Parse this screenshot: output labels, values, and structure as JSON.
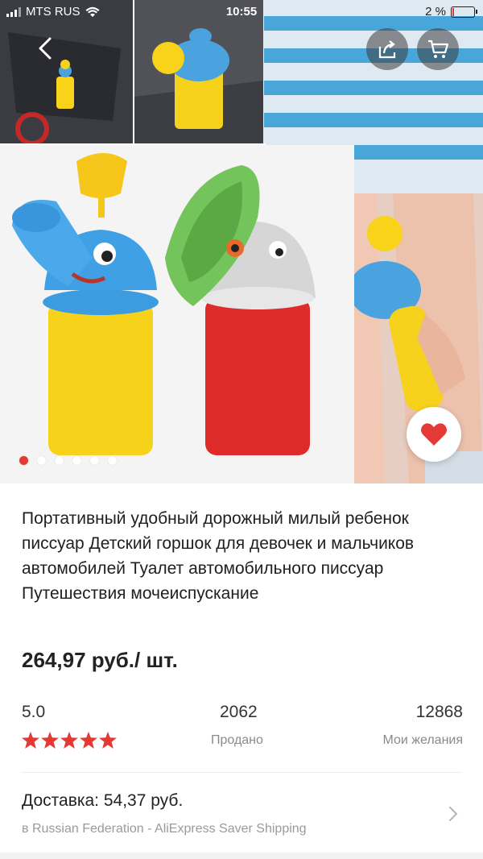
{
  "status_bar": {
    "carrier": "MTS RUS",
    "time": "10:55",
    "battery": "2 %"
  },
  "gallery": {
    "image_count": 6,
    "active_index": 0
  },
  "product": {
    "title": "Портативный удобный дорожный милый ребенок писсуар Детский горшок для девочек и мальчиков автомобилей Туалет автомобильного писсуар Путешествия мочеиспускание",
    "price": "264,97 руб./ шт."
  },
  "stats": {
    "rating": "5.0",
    "stars": 5,
    "sold_count": "2062",
    "sold_label": "Продано",
    "wishes_count": "12868",
    "wishes_label": "Мои желания"
  },
  "delivery": {
    "cost": "Доставка: 54,37 руб.",
    "details": "в Russian Federation - AliExpress Saver Shipping"
  },
  "colors": {
    "accent": "#e53935",
    "star": "#e53935"
  }
}
